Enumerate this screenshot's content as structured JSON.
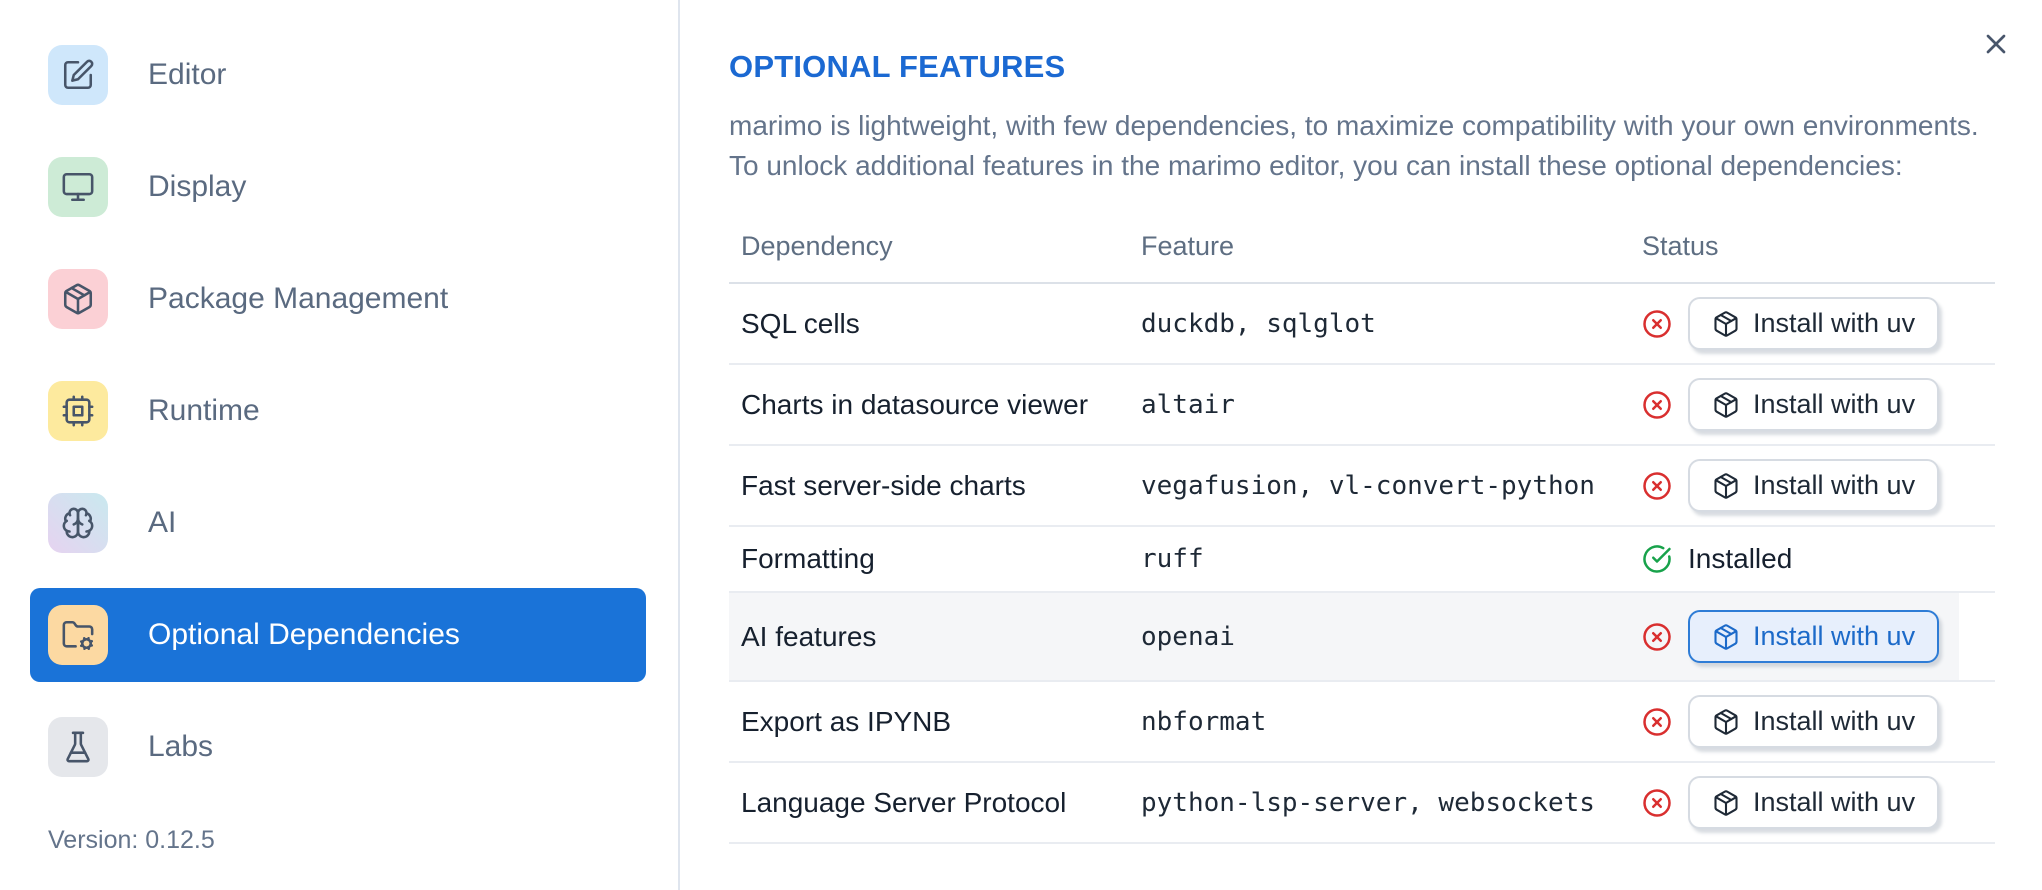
{
  "colors": {
    "accent": "#1a73d8",
    "title_blue": "#1b69d2",
    "error_red": "#d92f2f",
    "success_green": "#18a24b",
    "highlight_row_bg": "#f5f6f8",
    "focused_button_bg": "#e7effc",
    "focused_button_border": "#2e7cd6",
    "focused_button_text": "#1c6ac9"
  },
  "sidebar": {
    "items": [
      {
        "label": "Editor",
        "icon": "square-pen-icon",
        "icon_bg": "#cfe7fb",
        "active": false
      },
      {
        "label": "Display",
        "icon": "monitor-icon",
        "icon_bg": "#cdebd6",
        "active": false
      },
      {
        "label": "Package Management",
        "icon": "package-icon",
        "icon_bg": "#fbd0d5",
        "active": false
      },
      {
        "label": "Runtime",
        "icon": "cpu-icon",
        "icon_bg": "#fdea9e",
        "active": false
      },
      {
        "label": "AI",
        "icon": "brain-icon",
        "icon_bg": "#e6d3f0",
        "icon_bg_to": "#c9e9ef",
        "active": false
      },
      {
        "label": "Optional Dependencies",
        "icon": "folder-cog-icon",
        "icon_bg": "#fcd9a2",
        "active": true
      },
      {
        "label": "Labs",
        "icon": "flask-icon",
        "icon_bg": "#e5e7eb",
        "active": false
      }
    ],
    "version_label": "Version: 0.12.5"
  },
  "panel": {
    "title": "OPTIONAL FEATURES",
    "description_lines": [
      "marimo is lightweight, with few dependencies, to maximize compatibility with your own environments.",
      "To unlock additional features in the marimo editor, you can install these optional dependencies:"
    ],
    "close_icon": "x-icon",
    "table": {
      "columns": [
        "Dependency",
        "Feature",
        "Status"
      ],
      "install_button_label": "Install with uv",
      "install_button_icon": "package-icon",
      "installed_label": "Installed",
      "rows": [
        {
          "dependency": "SQL cells",
          "feature": "duckdb, sqlglot",
          "installed": false,
          "highlighted": false
        },
        {
          "dependency": "Charts in datasource viewer",
          "feature": "altair",
          "installed": false,
          "highlighted": false
        },
        {
          "dependency": "Fast server-side charts",
          "feature": "vegafusion, vl-convert-python",
          "installed": false,
          "highlighted": false
        },
        {
          "dependency": "Formatting",
          "feature": "ruff",
          "installed": true,
          "highlighted": false
        },
        {
          "dependency": "AI features",
          "feature": "openai",
          "installed": false,
          "highlighted": true
        },
        {
          "dependency": "Export as IPYNB",
          "feature": "nbformat",
          "installed": false,
          "highlighted": false
        },
        {
          "dependency": "Language Server Protocol",
          "feature": "python-lsp-server, websockets",
          "installed": false,
          "highlighted": false
        }
      ]
    }
  }
}
